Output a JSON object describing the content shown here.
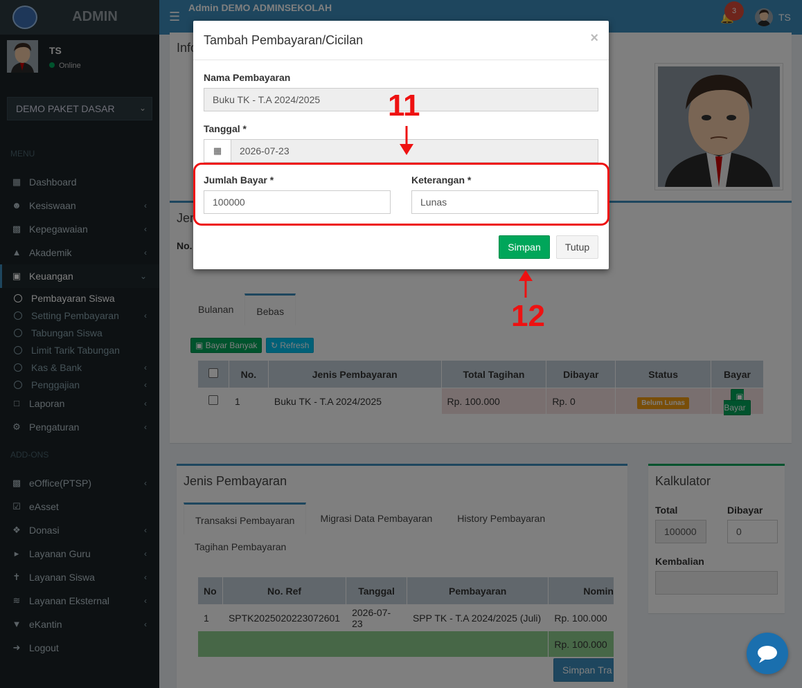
{
  "brand": {
    "text": "ADMIN"
  },
  "user": {
    "name": "TS",
    "status": "Online"
  },
  "package_select": {
    "value": "DEMO PAKET DASAR"
  },
  "menu": {
    "header_main": "MENU",
    "header_addons": "ADD-ONS",
    "items": [
      {
        "label": "Dashboard",
        "icon": "dashboard-icon"
      },
      {
        "label": "Kesiswaan",
        "icon": "users-icon"
      },
      {
        "label": "Kepegawaian",
        "icon": "briefcase-icon"
      },
      {
        "label": "Akademik",
        "icon": "graduation-cap-icon"
      },
      {
        "label": "Keuangan",
        "icon": "money-icon"
      },
      {
        "label": "Laporan",
        "icon": "file-icon"
      },
      {
        "label": "Pengaturan",
        "icon": "gear-icon"
      }
    ],
    "submenu": [
      {
        "label": "Pembayaran Siswa"
      },
      {
        "label": "Setting Pembayaran"
      },
      {
        "label": "Tabungan Siswa"
      },
      {
        "label": "Limit Tarik Tabungan"
      },
      {
        "label": "Kas & Bank"
      },
      {
        "label": "Penggajian"
      }
    ],
    "addons": [
      {
        "label": "eOffice(PTSP)",
        "icon": "building-icon"
      },
      {
        "label": "eAsset",
        "icon": "check-square-icon"
      },
      {
        "label": "Donasi",
        "icon": "dropbox-icon"
      },
      {
        "label": "Layanan Guru",
        "icon": "megaphone-icon"
      },
      {
        "label": "Layanan Siswa",
        "icon": "child-icon"
      },
      {
        "label": "Layanan Eksternal",
        "icon": "rss-icon"
      },
      {
        "label": "eKantin",
        "icon": "cart-icon"
      },
      {
        "label": "Logout",
        "icon": "sign-out-icon"
      }
    ]
  },
  "header": {
    "school": "Admin DEMO ADMINSEKOLAH",
    "notif_count": "3",
    "user_short": "TS"
  },
  "content": {
    "info_title_partial": "Info",
    "jenis_title_partial": "Jen",
    "no_label_partial": "No.",
    "tabs_top": [
      "Bulanan",
      "Bebas"
    ],
    "btn_bayar_banyak": "Bayar Banyak",
    "btn_refresh": "Refresh",
    "bebas_table": {
      "headers": [
        "No.",
        "Jenis Pembayaran",
        "Total Tagihan",
        "Dibayar",
        "Status",
        "Bayar"
      ],
      "rows": [
        {
          "no": "1",
          "jenis": "Buku TK - T.A 2024/2025",
          "total": "Rp. 100.000",
          "dibayar": "Rp. 0",
          "status": "Belum Lunas",
          "bayar": "Bayar"
        }
      ]
    },
    "jenis_box": {
      "title": "Jenis Pembayaran",
      "tabs": [
        "Transaksi Pembayaran",
        "Migrasi Data Pembayaran",
        "History Pembayaran",
        "Tagihan Pembayaran"
      ],
      "table": {
        "headers": [
          "No",
          "No. Ref",
          "Tanggal",
          "Pembayaran",
          "Nomina"
        ],
        "rows": [
          {
            "no": "1",
            "ref": "SPTK2025020223072601",
            "tanggal": "2026-07-23",
            "pembayaran": "SPP TK - T.A 2024/2025 (Juli)",
            "nominal": "Rp. 100.000"
          }
        ],
        "total": "Rp. 100.000"
      },
      "simpan_btn": "Simpan Tra"
    },
    "kalkulator": {
      "title": "Kalkulator",
      "total_label": "Total",
      "total_value": "100000",
      "dibayar_label": "Dibayar",
      "dibayar_value": "0",
      "kembalian_label": "Kembalian"
    }
  },
  "modal": {
    "title": "Tambah Pembayaran/Cicilan",
    "close": "×",
    "nama_label": "Nama Pembayaran",
    "nama_value": "Buku TK - T.A 2024/2025",
    "tanggal_label": "Tanggal *",
    "tanggal_value": "2026-07-23",
    "jumlah_label": "Jumlah Bayar *",
    "jumlah_value": "100000",
    "keterangan_label": "Keterangan *",
    "keterangan_value": "Lunas",
    "simpan": "Simpan",
    "tutup": "Tutup"
  },
  "annotations": {
    "step_a": "11",
    "step_b": "12",
    "color": "#ee1111"
  }
}
